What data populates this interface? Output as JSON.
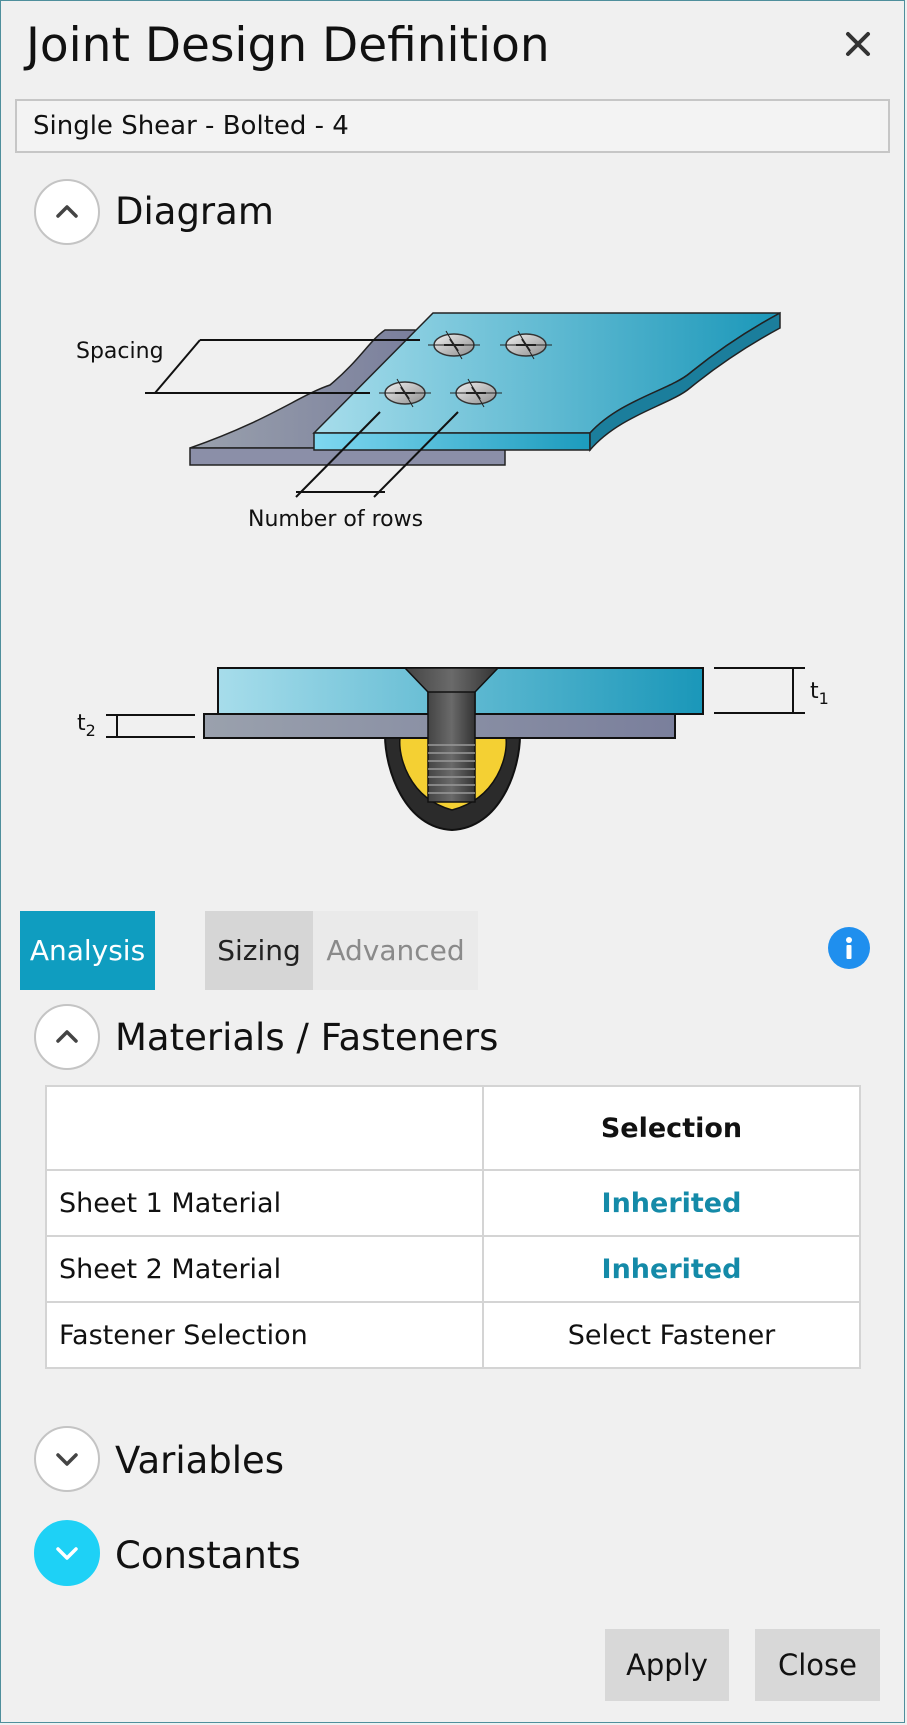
{
  "window": {
    "title": "Joint Design Definition"
  },
  "name_field": {
    "value": "Single Shear - Bolted - 4"
  },
  "sections": {
    "diagram": "Diagram",
    "materials": "Materials / Fasteners",
    "variables": "Variables",
    "constants": "Constants"
  },
  "diagram_labels": {
    "spacing": "Spacing",
    "rows": "Number of rows",
    "t1_base": "t",
    "t1_sub": "1",
    "t2_base": "t",
    "t2_sub": "2"
  },
  "tabs": [
    {
      "label": "Analysis",
      "state": "selected"
    },
    {
      "label": "Sizing",
      "state": "normal"
    },
    {
      "label": "Advanced",
      "state": "disabled"
    }
  ],
  "table": {
    "header": "Selection",
    "rows": [
      {
        "label": "Sheet 1 Material",
        "value": "Inherited"
      },
      {
        "label": "Sheet 2 Material",
        "value": "Inherited"
      },
      {
        "label": "Fastener Selection",
        "value": "Select Fastener"
      }
    ]
  },
  "buttons": {
    "apply": "Apply",
    "close": "Close"
  },
  "icons": {
    "close": "close-icon",
    "collapse": "chevron-up-icon",
    "expand": "chevron-down-icon",
    "info": "info-icon"
  },
  "colors": {
    "tab_selected": "#0f9dc0",
    "inherited_text": "#148aa8",
    "constants_toggle": "#1ed1f6",
    "info": "#1f8fee",
    "window_border": "#4e8f9c"
  }
}
